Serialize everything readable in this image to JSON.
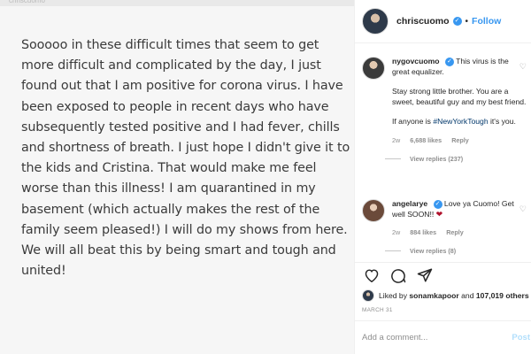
{
  "post": {
    "watermark": "chriscuomo",
    "text": "Sooooo in these difficult times that seem to get more difficult and complicated by the day, I just found out that I am positive for corona virus.  I have been exposed to people in recent days who have subsequently tested positive and I had fever, chills and shortness of breath. I just hope I didn't give it to the kids and Cristina. That would make me feel worse than this illness! I am quarantined in my basement (which actually makes the rest of the family seem pleased!) I will do my shows from here. We will all beat this by being smart and tough and united!"
  },
  "header": {
    "username": "chriscuomo",
    "separator": "•",
    "follow_label": "Follow"
  },
  "comments": [
    {
      "username": "nygovcuomo",
      "text": "This virus is the great equalizer.",
      "para2": "Stay strong little brother. You are a sweet, beautiful guy and my best friend.",
      "para3_prefix": "If anyone is ",
      "hashtag": "#NewYorkTough",
      "para3_suffix": " it's you.",
      "age": "2w",
      "likes": "6,688 likes",
      "reply_label": "Reply",
      "view_replies": "View replies (237)"
    },
    {
      "username": "angelarye",
      "text": "Love ya Cuomo! Get well SOON!!",
      "emoji": "❤",
      "age": "2w",
      "likes": "884 likes",
      "reply_label": "Reply",
      "view_replies": "View replies (8)"
    }
  ],
  "liked_by": {
    "prefix": "Liked by ",
    "user": "sonamkapoor",
    "middle": " and ",
    "count": "107,019 others"
  },
  "date": "MARCH 31",
  "add_comment": {
    "placeholder": "Add a comment...",
    "post_label": "Post"
  },
  "colors": {
    "accent": "#3897f0",
    "hashtag": "#00376b",
    "muted": "#8e8e8e"
  }
}
